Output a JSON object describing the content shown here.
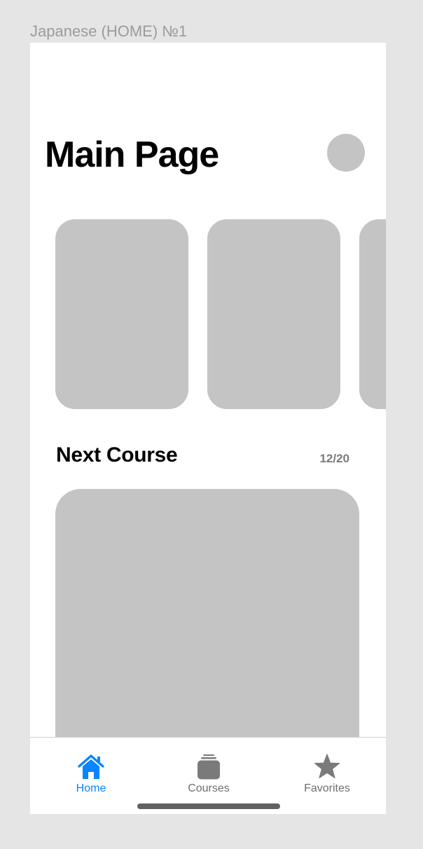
{
  "frame": {
    "label": "Japanese (HOME) №1"
  },
  "header": {
    "title": "Main Page"
  },
  "next_course": {
    "title": "Next Course",
    "progress": "12/20"
  },
  "tab_bar": {
    "tabs": [
      {
        "label": "Home",
        "icon": "home-icon",
        "active": true
      },
      {
        "label": "Courses",
        "icon": "stack-icon",
        "active": false
      },
      {
        "label": "Favorites",
        "icon": "star-icon",
        "active": false
      }
    ]
  },
  "colors": {
    "accent": "#0a84ff",
    "placeholder": "#c4c4c4",
    "inactive_tab": "#6e6e6e",
    "canvas": "#e5e5e5"
  }
}
